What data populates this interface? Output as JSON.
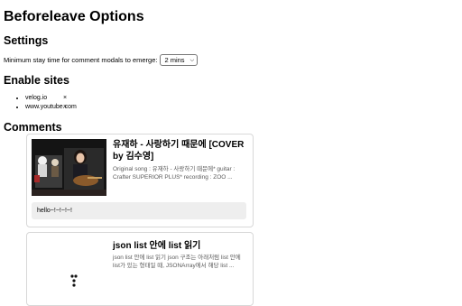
{
  "app": {
    "title": "Beforeleave Options"
  },
  "settings": {
    "heading": "Settings",
    "stay_label": "Minimum stay time for comment modals to emerge:",
    "stay_value": "2 mins"
  },
  "sites": {
    "heading": "Enable sites",
    "remove_symbol": "×",
    "items": [
      {
        "name": "velog.io"
      },
      {
        "name": "www.youtube.com"
      }
    ]
  },
  "comments": {
    "heading": "Comments",
    "items": [
      {
        "title": "유재하 - 사랑하기 때문에 [COVER by 김수영]",
        "desc": "Original song : 유재하 - 사랑하기 때문에* guitar : Crafter SUPERIOR PLUS* recording : ZOO ...",
        "comment": "hello~!~!~!~!"
      },
      {
        "title": "json list 안에 list 읽기",
        "desc": "json list 안에 list 읽기 json 구조는 아래처럼 list 안에 list가 있는 형태일 때, JSONArray에서 해당 list ..."
      }
    ]
  }
}
